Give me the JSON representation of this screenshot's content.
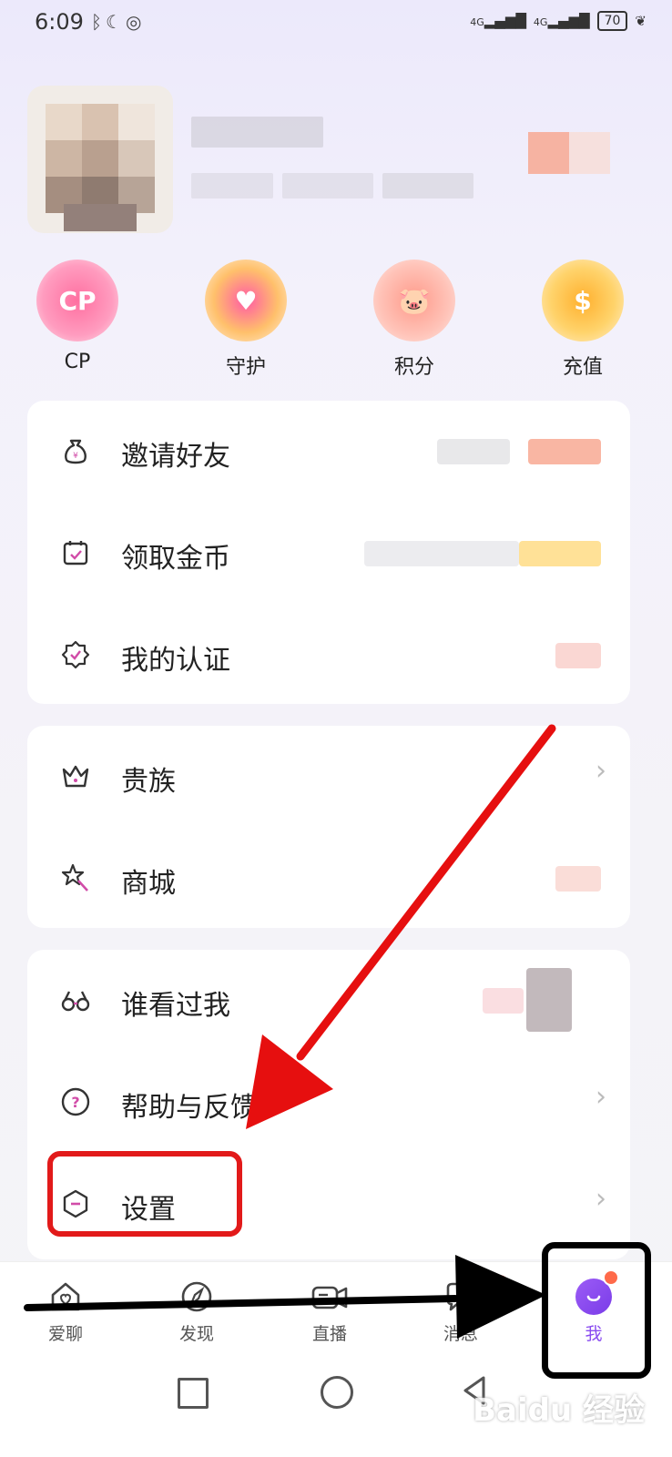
{
  "status_bar": {
    "time": "6:09",
    "signal1": "4G",
    "signal2": "4G",
    "battery": "70"
  },
  "quick_actions": [
    {
      "label": "CP",
      "badge": "CP"
    },
    {
      "label": "守护"
    },
    {
      "label": "积分"
    },
    {
      "label": "充值",
      "badge": "$"
    }
  ],
  "menu_group_1": [
    {
      "label": "邀请好友",
      "icon": "money-bag-icon"
    },
    {
      "label": "领取金币",
      "icon": "calendar-check-icon"
    },
    {
      "label": "我的认证",
      "icon": "verified-badge-icon"
    }
  ],
  "menu_group_2": [
    {
      "label": "贵族",
      "icon": "crown-icon"
    },
    {
      "label": "商城",
      "icon": "magic-wand-star-icon"
    }
  ],
  "menu_group_3": [
    {
      "label": "谁看过我",
      "icon": "glasses-icon"
    },
    {
      "label": "帮助与反馈",
      "icon": "help-circle-icon"
    },
    {
      "label": "设置",
      "icon": "settings-hexagon-icon"
    }
  ],
  "bottom_nav": [
    {
      "label": "爱聊",
      "icon": "home-heart-icon"
    },
    {
      "label": "发现",
      "icon": "compass-icon"
    },
    {
      "label": "直播",
      "icon": "video-camera-icon"
    },
    {
      "label": "消息",
      "icon": "message-icon"
    },
    {
      "label": "我",
      "icon": "profile-avatar-icon",
      "active": true
    }
  ],
  "colors": {
    "accent": "#8a4cf0",
    "annotation_red": "#e21a1a",
    "badge": "#ff6a4a"
  },
  "watermark": "Baidu 经验"
}
